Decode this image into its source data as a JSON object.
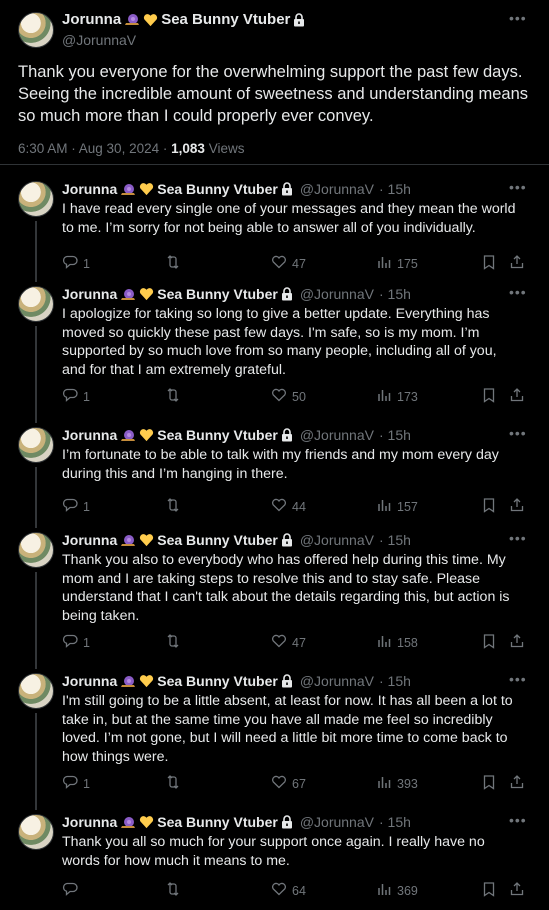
{
  "main": {
    "name": "Jorunna",
    "name_suffix": "Sea Bunny Vtuber",
    "handle": "@JorunnaV",
    "text": "Thank you everyone for the overwhelming support the past few days. Seeing the incredible amount of sweetness and understanding means so much more than I could properly ever convey.",
    "time": "6:30 AM · Aug 30, 2024 ·",
    "views_count": "1,083",
    "views_label": "Views"
  },
  "replies": [
    {
      "name": "Jorunna",
      "name_suffix": "Sea Bunny Vtuber",
      "handle": "@JorunnaV",
      "time": "· 15h",
      "text": "I have read every single one of your messages and they mean the world to me. I’m sorry for not being able to answer all of you individually.",
      "replies": "1",
      "reposts": "",
      "likes": "47",
      "views": "175"
    },
    {
      "name": "Jorunna",
      "name_suffix": "Sea Bunny Vtuber",
      "handle": "@JorunnaV",
      "time": "· 15h",
      "text": "I apologize for taking so long to give a better update. Everything has moved so quickly these past few days. I'm safe, so is my mom. I’m supported by so much love from so many people, including all of you, and for that I am extremely grateful.",
      "replies": "1",
      "reposts": "",
      "likes": "50",
      "views": "173"
    },
    {
      "name": "Jorunna",
      "name_suffix": "Sea Bunny Vtuber",
      "handle": "@JorunnaV",
      "time": "· 15h",
      "text": "I’m fortunate to be able to talk with my friends and my mom every day during this and I’m hanging in there.",
      "replies": "1",
      "reposts": "",
      "likes": "44",
      "views": "157"
    },
    {
      "name": "Jorunna",
      "name_suffix": "Sea Bunny Vtuber",
      "handle": "@JorunnaV",
      "time": "· 15h",
      "text": "Thank you also to everybody who has offered help during this time. My mom and I are taking steps to resolve this and to stay safe. Please understand that I can't talk about the details regarding this, but action is being taken.",
      "replies": "1",
      "reposts": "",
      "likes": "47",
      "views": "158"
    },
    {
      "name": "Jorunna",
      "name_suffix": "Sea Bunny Vtuber",
      "handle": "@JorunnaV",
      "time": "· 15h",
      "text": "I'm still going to be a little absent, at least for now. It has all been a lot to take in, but at the same time you have all made me feel so incredibly loved. I’m not gone, but I will need a little bit more time to come back to how things were.",
      "replies": "1",
      "reposts": "",
      "likes": "67",
      "views": "393"
    },
    {
      "name": "Jorunna",
      "name_suffix": "Sea Bunny Vtuber",
      "handle": "@JorunnaV",
      "time": "· 15h",
      "text": "Thank you all so much for your support once again. I really have no words for how much it means to me.",
      "replies": "",
      "reposts": "",
      "likes": "64",
      "views": "369"
    }
  ],
  "icons": {
    "more": "more-icon",
    "reply": "reply-icon",
    "repost": "repost-icon",
    "like": "like-icon",
    "views": "views-icon",
    "bookmark": "bookmark-icon",
    "share": "share-icon",
    "lock": "lock-icon",
    "snail_emoji": "snail-emoji-icon",
    "heart_emoji": "yellow-heart-emoji-icon"
  },
  "colors": {
    "background": "#000000",
    "text": "#e7e9ea",
    "muted": "#71767b",
    "divider": "#2f3336"
  }
}
